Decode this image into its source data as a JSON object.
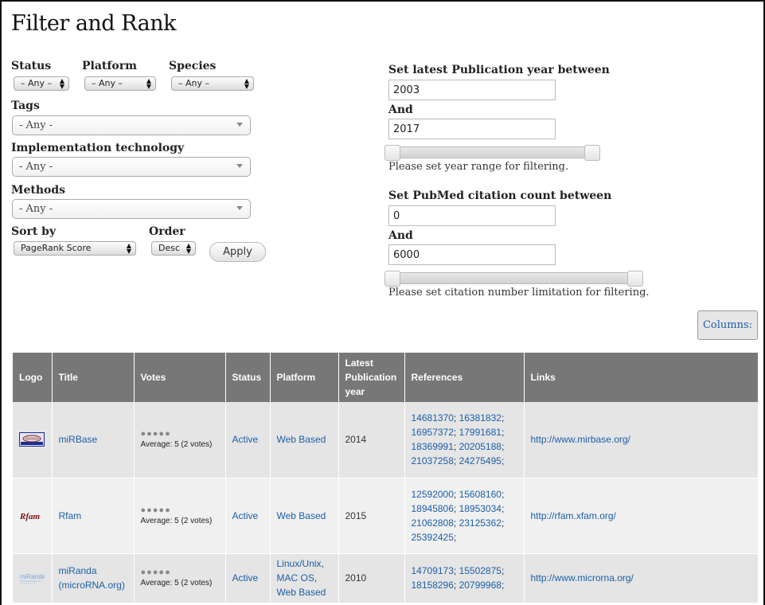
{
  "page": {
    "title": "Filter and Rank"
  },
  "filters": {
    "status": {
      "label": "Status",
      "value": "– Any –"
    },
    "platform": {
      "label": "Platform",
      "value": "– Any –"
    },
    "species": {
      "label": "Species",
      "value": "– Any –"
    },
    "tags": {
      "label": "Tags",
      "value": "- Any -"
    },
    "implementation": {
      "label": "Implementation technology",
      "value": "- Any -"
    },
    "methods": {
      "label": "Methods",
      "value": "- Any -"
    },
    "sort_by": {
      "label": "Sort by",
      "value": "PageRank Score"
    },
    "order": {
      "label": "Order",
      "value": "Desc"
    },
    "apply_label": "Apply"
  },
  "year_range": {
    "label": "Set latest Publication year between",
    "and_label": "And",
    "min": "2003",
    "max": "2017",
    "help": "Please set year range for filtering."
  },
  "citation_range": {
    "label": "Set PubMed citation count between",
    "and_label": "And",
    "min": "0",
    "max": "6000",
    "help": "Please set citation number limitation for filtering."
  },
  "columns_button": "Columns:",
  "table": {
    "headers": {
      "logo": "Logo",
      "title": "Title",
      "votes": "Votes",
      "status": "Status",
      "platform": "Platform",
      "year_l1": "Latest",
      "year_l2": "Publication",
      "year_l3": "year",
      "references": "References",
      "links": "Links"
    },
    "rows": [
      {
        "logo_text": "miRBase",
        "title": "miRBase",
        "stars": "●●●●●",
        "average": "Average: 5 (2 votes)",
        "status": "Active",
        "platform": [
          "Web Based"
        ],
        "year": "2014",
        "references": [
          "14681370",
          "16381832",
          "16957372",
          "17991681",
          "18369991",
          "20205188",
          "21037258",
          "24275495"
        ],
        "link": "http://www.mirbase.org/"
      },
      {
        "logo_text": "Rfam",
        "title": "Rfam",
        "stars": "●●●●●",
        "average": "Average: 5 (2 votes)",
        "status": "Active",
        "platform": [
          "Web Based"
        ],
        "year": "2015",
        "references": [
          "12592000",
          "15608160",
          "18945806",
          "18953034",
          "21062808",
          "23125362",
          "25392425"
        ],
        "link": "http://rfam.xfam.org/"
      },
      {
        "logo_text": "miRanda",
        "title_l1": "miRanda",
        "title_l2": "(microRNA.org)",
        "stars": "●●●●●",
        "average": "Average: 5 (2 votes)",
        "status": "Active",
        "platform": [
          "Linux/Unix",
          "MAC OS",
          "Web Based"
        ],
        "year": "2010",
        "references": [
          "14709173",
          "15502875",
          "18158296",
          "20799968"
        ],
        "link": "http://www.microrna.org/"
      }
    ]
  }
}
